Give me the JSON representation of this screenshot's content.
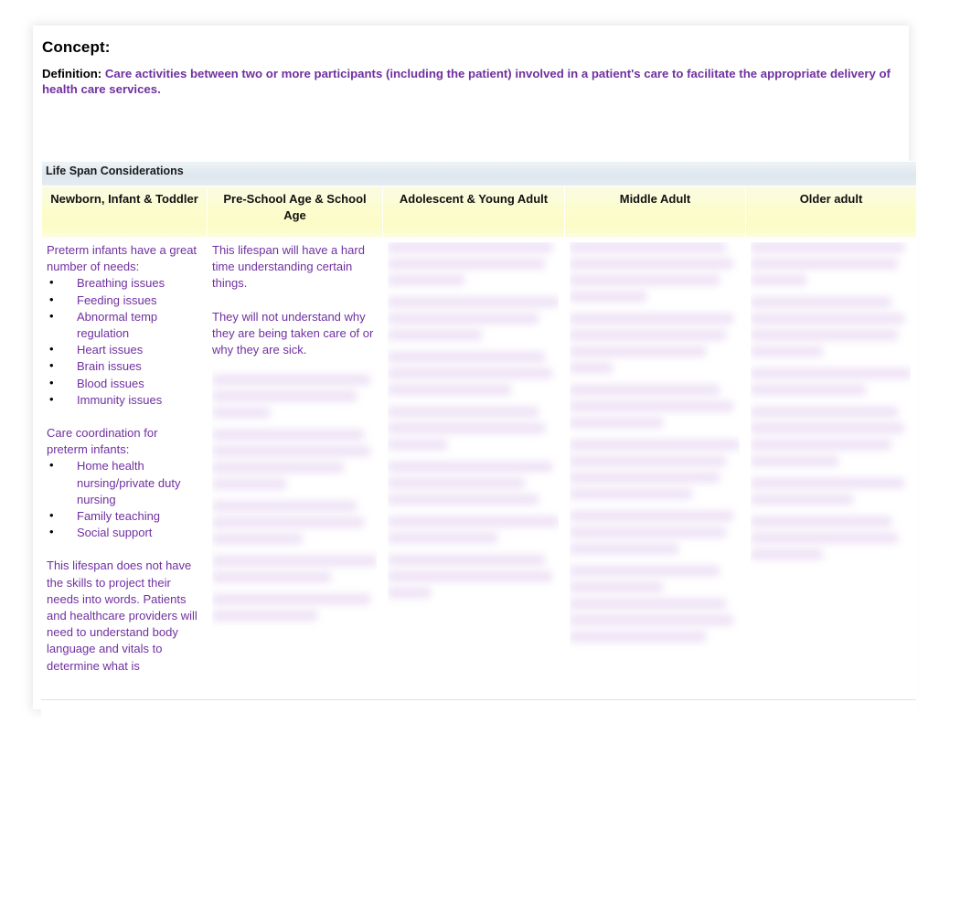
{
  "document": {
    "concept_title": "Concept:",
    "definition_label": "Definition:",
    "definition_text": "Care activities between two or more participants (including the patient) involved in a patient's care to facilitate the appropriate delivery of health care services."
  },
  "table": {
    "banner_title": "Life Span Considerations",
    "columns": [
      {
        "header": "Newborn, Infant & Toddler"
      },
      {
        "header": "Pre-School Age & School Age"
      },
      {
        "header": "Adolescent & Young Adult"
      },
      {
        "header": "Middle Adult"
      },
      {
        "header": "Older adult"
      }
    ],
    "cells": {
      "newborn": {
        "intro": "Preterm infants have a great number of needs:",
        "needs": [
          "Breathing issues",
          "Feeding issues",
          "Abnormal temp regulation",
          "Heart issues",
          "Brain issues",
          "Blood issues",
          "Immunity issues"
        ],
        "care_intro": "Care coordination for preterm infants:",
        "care_items": [
          "Home health nursing/private duty nursing",
          "Family teaching",
          "Social support"
        ],
        "closing": "This lifespan does not have the skills to project their needs into words. Patients and healthcare providers will need to understand body language and vitals to determine what is"
      },
      "preschool": {
        "paragraph_1": "This lifespan will have a hard time understanding certain things.",
        "paragraph_2": "They will not understand why they are being taken care of or why they are sick."
      }
    }
  },
  "colors": {
    "accent_purple": "#7030a0",
    "banner_blue": "#dde7ef",
    "header_yellow": "#fcfcc8",
    "text_black": "#000000"
  }
}
